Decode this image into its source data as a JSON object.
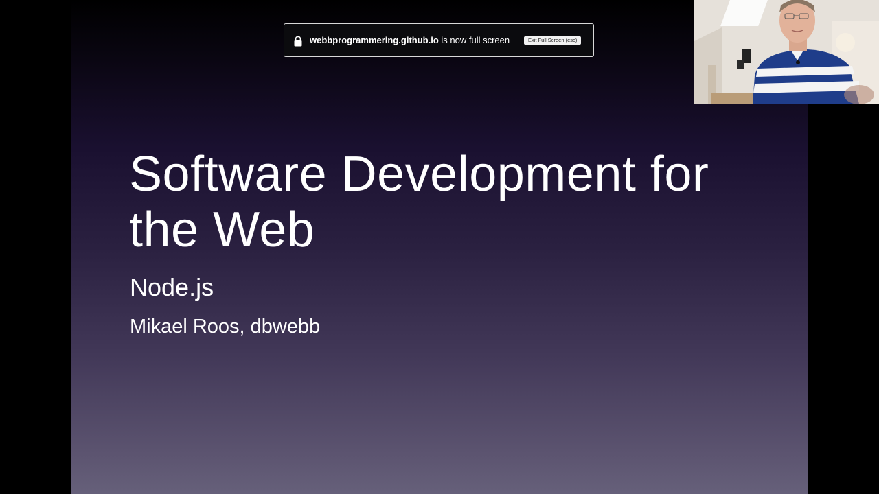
{
  "slide": {
    "title": "Software Development for the Web",
    "subtitle": "Node.js",
    "author": "Mikael Roos, dbwebb"
  },
  "fullscreen_banner": {
    "domain": "webbprogrammering.github.io",
    "message": " is now full screen",
    "exit_label": "Exit Full Screen (esc)",
    "lock_icon": "lock-icon"
  },
  "webcam": {
    "content": "presenter-video"
  }
}
